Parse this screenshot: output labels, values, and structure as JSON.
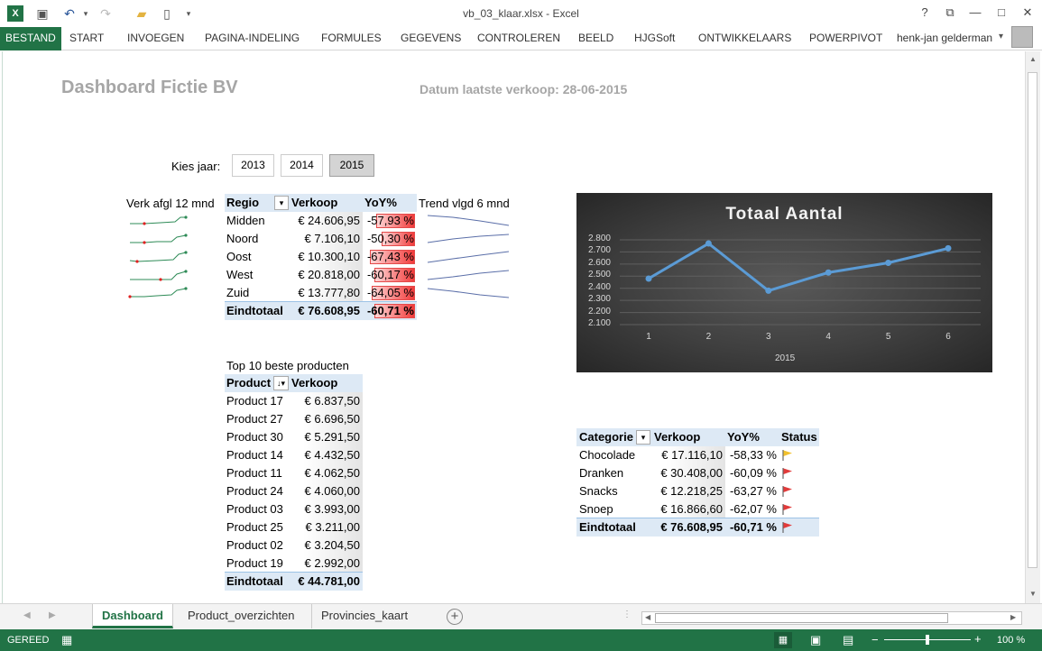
{
  "window": {
    "title": "vb_03_klaar.xlsx - Excel",
    "help": "?",
    "minimize": "—",
    "restore": "□",
    "close": "✕"
  },
  "ribbon": {
    "tabs": [
      "BESTAND",
      "START",
      "INVOEGEN",
      "PAGINA-INDELING",
      "FORMULES",
      "GEGEVENS",
      "CONTROLEREN",
      "BEELD",
      "HJGSoft",
      "ONTWIKKELAARS",
      "POWERPIVOT"
    ],
    "user": "henk-jan gelderman",
    "accent": "#217346"
  },
  "dashboard": {
    "title": "Dashboard Fictie BV",
    "date_label": "Datum laatste verkoop: 28-06-2015",
    "slicer": {
      "label": "Kies jaar:",
      "options": [
        "2013",
        "2014",
        "2015"
      ],
      "selected": "2015"
    },
    "sparkline_label": "Verk afgl 12 mnd",
    "trend_label": "Trend vlgd 6 mnd"
  },
  "region_table": {
    "headers": [
      "Regio",
      "Verkoop",
      "YoY%"
    ],
    "rows": [
      {
        "name": "Midden",
        "sales": "€ 24.606,95",
        "yoy": "-57,93 %",
        "yoy_val": -57.93
      },
      {
        "name": "Noord",
        "sales": "€ 7.106,10",
        "yoy": "-50,30 %",
        "yoy_val": -50.3
      },
      {
        "name": "Oost",
        "sales": "€ 10.300,10",
        "yoy": "-67,43 %",
        "yoy_val": -67.43
      },
      {
        "name": "West",
        "sales": "€ 20.818,00",
        "yoy": "-60,17 %",
        "yoy_val": -60.17
      },
      {
        "name": "Zuid",
        "sales": "€ 13.777,80",
        "yoy": "-64,05 %",
        "yoy_val": -64.05
      }
    ],
    "total": {
      "name": "Eindtotaal",
      "sales": "€ 76.608,95",
      "yoy": "-60,71 %",
      "yoy_val": -60.71
    }
  },
  "products_table": {
    "caption": "Top 10 beste producten",
    "headers": [
      "Product",
      "Verkoop"
    ],
    "rows": [
      {
        "name": "Product 17",
        "sales": "€ 6.837,50"
      },
      {
        "name": "Product 27",
        "sales": "€ 6.696,50"
      },
      {
        "name": "Product 30",
        "sales": "€ 5.291,50"
      },
      {
        "name": "Product 14",
        "sales": "€ 4.432,50"
      },
      {
        "name": "Product 11",
        "sales": "€ 4.062,50"
      },
      {
        "name": "Product 24",
        "sales": "€ 4.060,00"
      },
      {
        "name": "Product 03",
        "sales": "€ 3.993,00"
      },
      {
        "name": "Product 25",
        "sales": "€ 3.211,00"
      },
      {
        "name": "Product 02",
        "sales": "€ 3.204,50"
      },
      {
        "name": "Product 19",
        "sales": "€ 2.992,00"
      }
    ],
    "total": {
      "name": "Eindtotaal",
      "sales": "€ 44.781,00"
    }
  },
  "category_table": {
    "headers": [
      "Categorie",
      "Verkoop",
      "YoY%",
      "Status"
    ],
    "rows": [
      {
        "name": "Chocolade",
        "sales": "€ 17.116,10",
        "yoy": "-58,33 %",
        "status_icon": "yellow-flag-icon"
      },
      {
        "name": "Dranken",
        "sales": "€ 30.408,00",
        "yoy": "-60,09 %",
        "status_icon": "red-flag-icon"
      },
      {
        "name": "Snacks",
        "sales": "€ 12.218,25",
        "yoy": "-63,27 %",
        "status_icon": "red-flag-icon"
      },
      {
        "name": "Snoep",
        "sales": "€ 16.866,60",
        "yoy": "-62,07 %",
        "status_icon": "red-flag-icon"
      }
    ],
    "total": {
      "name": "Eindtotaal",
      "sales": "€ 76.608,95",
      "yoy": "-60,71 %",
      "status_icon": "red-flag-icon"
    }
  },
  "chart_data": {
    "type": "line",
    "title": "Totaal Aantal",
    "x": [
      1,
      2,
      3,
      4,
      5,
      6
    ],
    "categories": [
      "1",
      "2",
      "3",
      "4",
      "5",
      "6"
    ],
    "xlabel": "2015",
    "series": [
      {
        "values": [
          2480,
          2770,
          2380,
          2530,
          2610,
          2730
        ]
      }
    ],
    "yticks": [
      "2.100",
      "2.200",
      "2.300",
      "2.400",
      "2.500",
      "2.600",
      "2.700",
      "2.800"
    ],
    "ylim": [
      2100,
      2800
    ],
    "grid": true,
    "color": "#5b9bd5",
    "background": "#404040"
  },
  "sheet_tabs": [
    "Dashboard",
    "Product_overzichten",
    "Provincies_kaart"
  ],
  "active_sheet": "Dashboard",
  "status": {
    "mode": "GEREED",
    "zoom": "100 %"
  }
}
